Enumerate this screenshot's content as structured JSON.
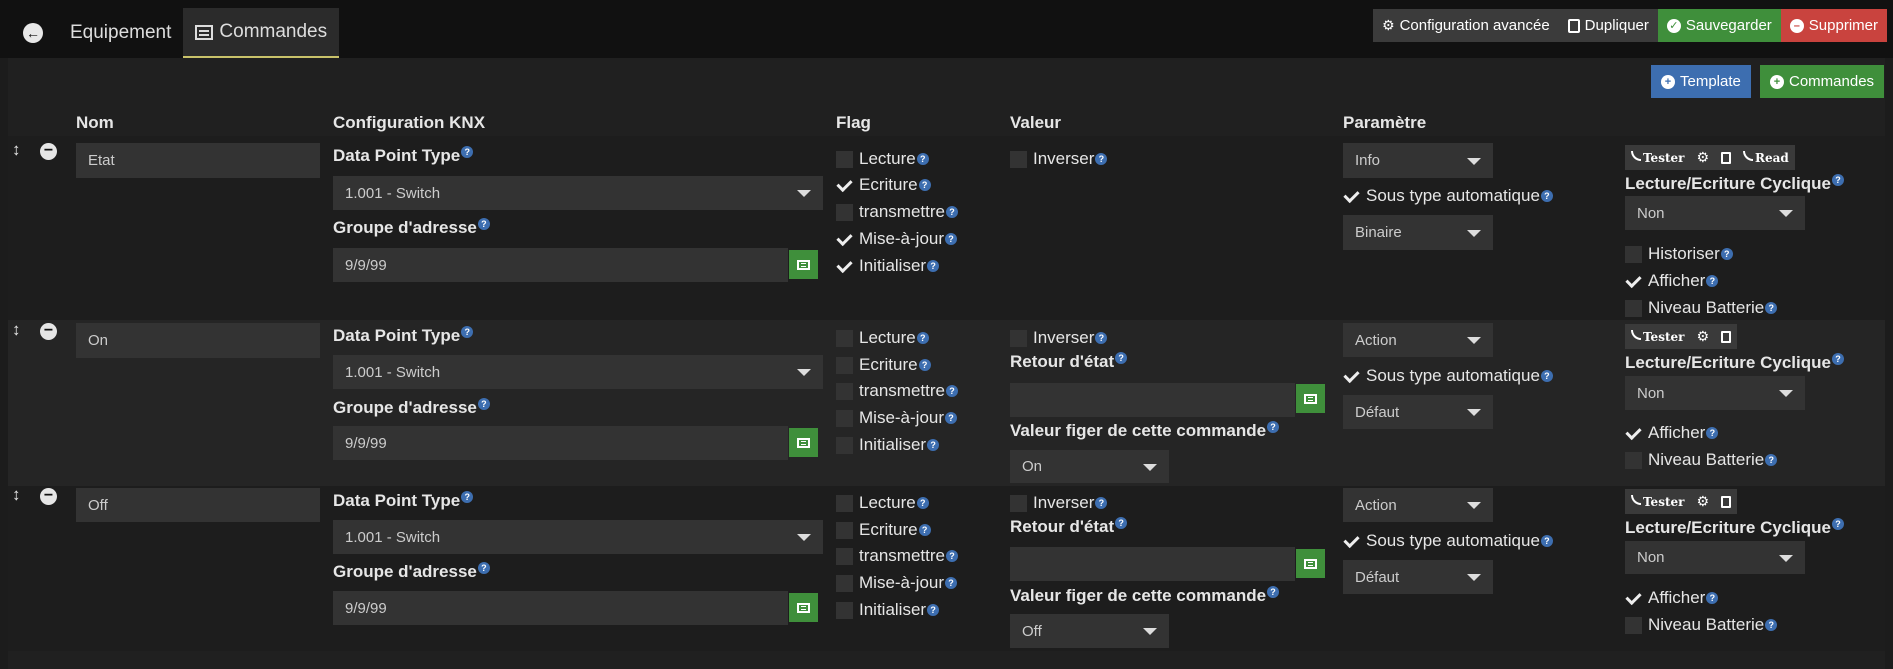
{
  "tabs": {
    "equipment": "Equipement",
    "commands": "Commandes"
  },
  "actions": {
    "advanced": "Configuration avancée",
    "duplicate": "Dupliquer",
    "save": "Sauvegarder",
    "delete": "Supprimer",
    "template": "Template",
    "add_commands": "Commandes"
  },
  "columns": {
    "name": "Nom",
    "knx": "Configuration KNX",
    "flag": "Flag",
    "value": "Valeur",
    "param": "Paramètre"
  },
  "labels": {
    "dpt": "Data Point Type",
    "group": "Groupe d'adresse",
    "lecture": "Lecture",
    "ecriture": "Ecriture",
    "transmettre": "transmettre",
    "maj": "Mise-à-jour",
    "init": "Initialiser",
    "inverser": "Inverser",
    "retour": "Retour d'état",
    "figer": "Valeur figer de cette commande",
    "sous_type": "Sous type automatique",
    "cyclique": "Lecture/Ecriture Cyclique",
    "historiser": "Historiser",
    "afficher": "Afficher",
    "batterie": "Niveau Batterie",
    "tester": "Tester",
    "read": "Read",
    "help": "?"
  },
  "commands": [
    {
      "name": "Etat",
      "dpt": "1.001 - Switch",
      "group": "9/9/99",
      "flags": {
        "lecture": false,
        "ecriture": true,
        "transmettre": false,
        "maj": true,
        "init": true
      },
      "inverser": false,
      "type": "Info",
      "subtype": "Binaire",
      "sous_type_auto": true,
      "cyclique": "Non",
      "historiser": false,
      "afficher": true,
      "batterie": false
    },
    {
      "name": "On",
      "dpt": "1.001 - Switch",
      "group": "9/9/99",
      "flags": {
        "lecture": false,
        "ecriture": false,
        "transmettre": false,
        "maj": false,
        "init": false
      },
      "inverser": false,
      "retour": "",
      "figer": "On",
      "type": "Action",
      "subtype": "Défaut",
      "sous_type_auto": true,
      "cyclique": "Non",
      "afficher": true,
      "batterie": false
    },
    {
      "name": "Off",
      "dpt": "1.001 - Switch",
      "group": "9/9/99",
      "flags": {
        "lecture": false,
        "ecriture": false,
        "transmettre": false,
        "maj": false,
        "init": false
      },
      "inverser": false,
      "retour": "",
      "figer": "Off",
      "type": "Action",
      "subtype": "Défaut",
      "sous_type_auto": true,
      "cyclique": "Non",
      "afficher": true,
      "batterie": false
    }
  ]
}
